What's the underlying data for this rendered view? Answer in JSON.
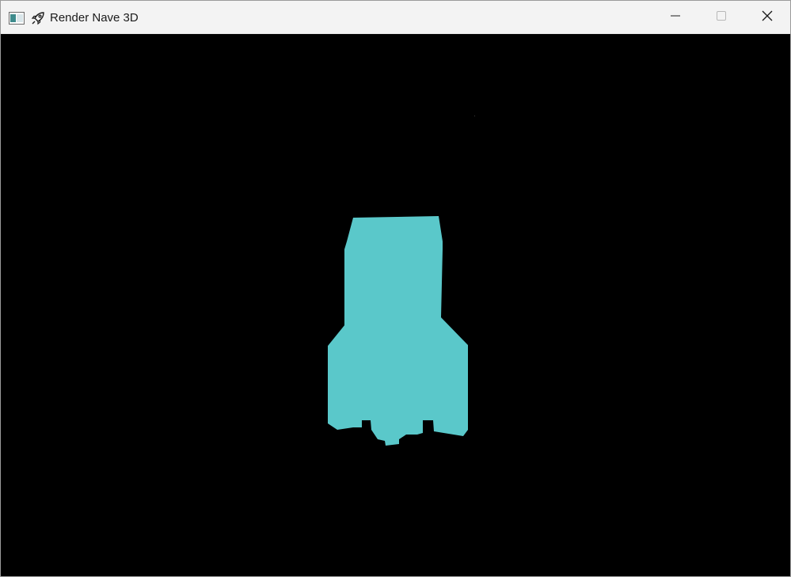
{
  "window": {
    "title": "Render Nave 3D",
    "icons": {
      "app": "app-window-icon",
      "title_emoji": "rocket-icon",
      "minimize": "minimize-icon",
      "maximize": "maximize-icon",
      "close": "close-icon"
    }
  },
  "scene": {
    "background_color": "#000000",
    "object": "ship-silhouette",
    "object_color": "#5ac8ca"
  }
}
